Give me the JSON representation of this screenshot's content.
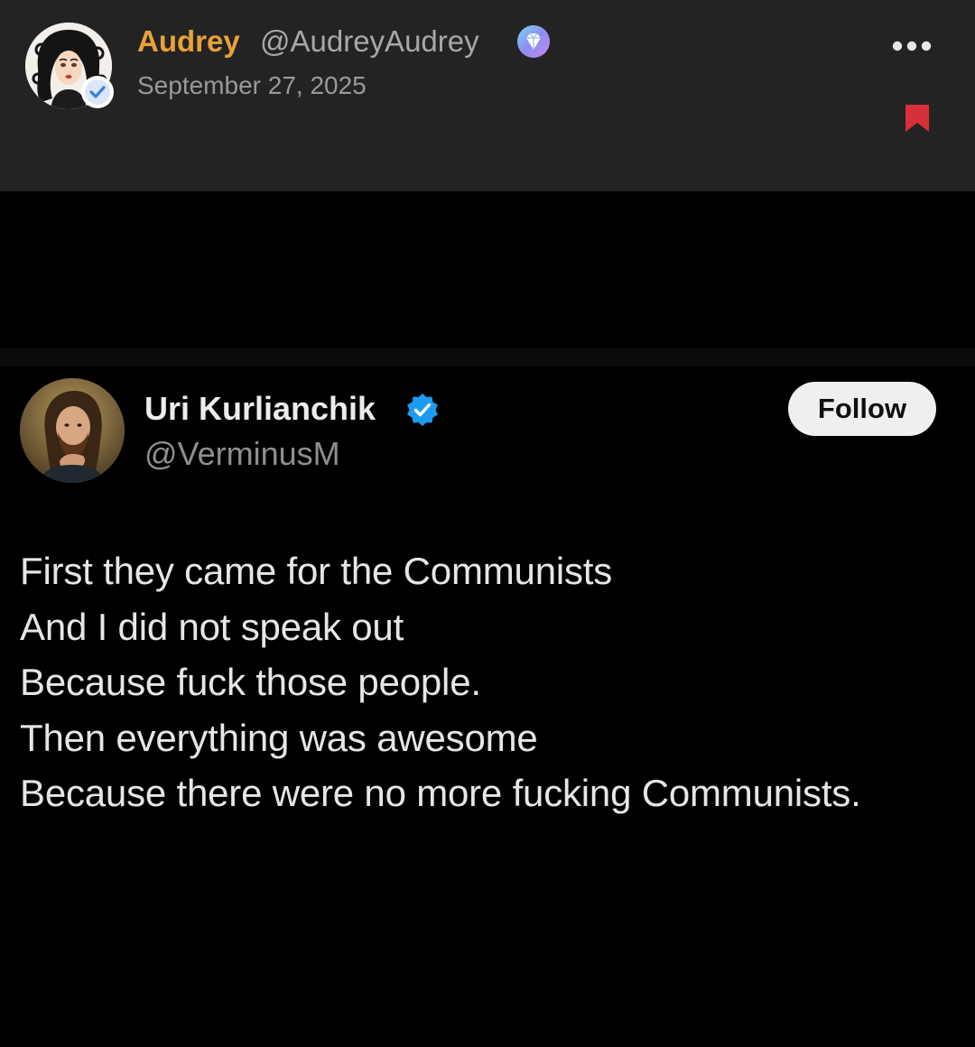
{
  "post": {
    "author_name": "Audrey",
    "author_handle": "@AudreyAudrey",
    "date": "September 27, 2025",
    "icons": {
      "avatar": "cartoon-woman-avatar",
      "verified": "verified-badge-icon",
      "premium": "diamond-icon",
      "more": "more-dots-icon",
      "bookmark": "bookmark-icon"
    },
    "colors": {
      "author_name": "#e8a13a",
      "bookmark": "#d8303a",
      "header_bg": "#232323"
    }
  },
  "embedded_tweet": {
    "name": "Uri Kurlianchik",
    "handle": "@VerminusM",
    "follow_label": "Follow",
    "lines": [
      "First they came for the Communists",
      "And I did not speak out",
      "Because fuck those people.",
      "Then everything was awesome",
      "Because there were no more fucking Communists."
    ],
    "icons": {
      "avatar": "bearded-man-avatar",
      "verified": "verified-check-icon"
    },
    "colors": {
      "verified": "#1d9bf0",
      "follow_bg": "#efefef"
    }
  }
}
